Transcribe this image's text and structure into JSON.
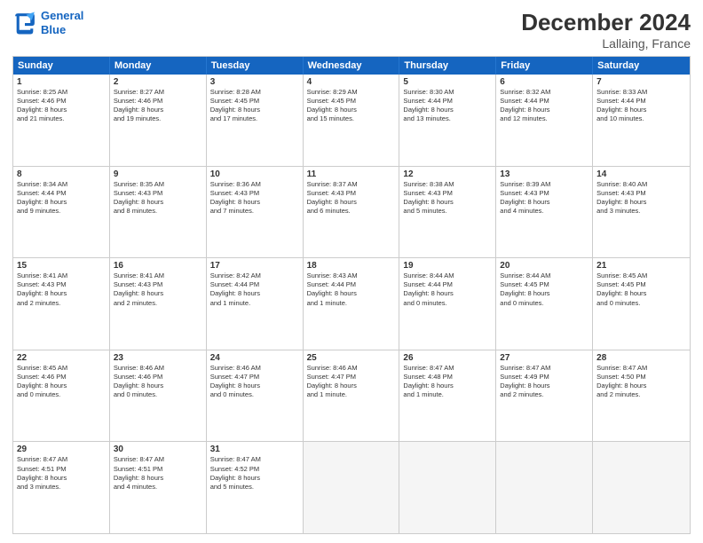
{
  "logo": {
    "line1": "General",
    "line2": "Blue"
  },
  "title": "December 2024",
  "subtitle": "Lallaing, France",
  "header": {
    "days": [
      "Sunday",
      "Monday",
      "Tuesday",
      "Wednesday",
      "Thursday",
      "Friday",
      "Saturday"
    ]
  },
  "rows": [
    [
      {
        "day": "1",
        "lines": [
          "Sunrise: 8:25 AM",
          "Sunset: 4:46 PM",
          "Daylight: 8 hours",
          "and 21 minutes."
        ]
      },
      {
        "day": "2",
        "lines": [
          "Sunrise: 8:27 AM",
          "Sunset: 4:46 PM",
          "Daylight: 8 hours",
          "and 19 minutes."
        ]
      },
      {
        "day": "3",
        "lines": [
          "Sunrise: 8:28 AM",
          "Sunset: 4:45 PM",
          "Daylight: 8 hours",
          "and 17 minutes."
        ]
      },
      {
        "day": "4",
        "lines": [
          "Sunrise: 8:29 AM",
          "Sunset: 4:45 PM",
          "Daylight: 8 hours",
          "and 15 minutes."
        ]
      },
      {
        "day": "5",
        "lines": [
          "Sunrise: 8:30 AM",
          "Sunset: 4:44 PM",
          "Daylight: 8 hours",
          "and 13 minutes."
        ]
      },
      {
        "day": "6",
        "lines": [
          "Sunrise: 8:32 AM",
          "Sunset: 4:44 PM",
          "Daylight: 8 hours",
          "and 12 minutes."
        ]
      },
      {
        "day": "7",
        "lines": [
          "Sunrise: 8:33 AM",
          "Sunset: 4:44 PM",
          "Daylight: 8 hours",
          "and 10 minutes."
        ]
      }
    ],
    [
      {
        "day": "8",
        "lines": [
          "Sunrise: 8:34 AM",
          "Sunset: 4:44 PM",
          "Daylight: 8 hours",
          "and 9 minutes."
        ]
      },
      {
        "day": "9",
        "lines": [
          "Sunrise: 8:35 AM",
          "Sunset: 4:43 PM",
          "Daylight: 8 hours",
          "and 8 minutes."
        ]
      },
      {
        "day": "10",
        "lines": [
          "Sunrise: 8:36 AM",
          "Sunset: 4:43 PM",
          "Daylight: 8 hours",
          "and 7 minutes."
        ]
      },
      {
        "day": "11",
        "lines": [
          "Sunrise: 8:37 AM",
          "Sunset: 4:43 PM",
          "Daylight: 8 hours",
          "and 6 minutes."
        ]
      },
      {
        "day": "12",
        "lines": [
          "Sunrise: 8:38 AM",
          "Sunset: 4:43 PM",
          "Daylight: 8 hours",
          "and 5 minutes."
        ]
      },
      {
        "day": "13",
        "lines": [
          "Sunrise: 8:39 AM",
          "Sunset: 4:43 PM",
          "Daylight: 8 hours",
          "and 4 minutes."
        ]
      },
      {
        "day": "14",
        "lines": [
          "Sunrise: 8:40 AM",
          "Sunset: 4:43 PM",
          "Daylight: 8 hours",
          "and 3 minutes."
        ]
      }
    ],
    [
      {
        "day": "15",
        "lines": [
          "Sunrise: 8:41 AM",
          "Sunset: 4:43 PM",
          "Daylight: 8 hours",
          "and 2 minutes."
        ]
      },
      {
        "day": "16",
        "lines": [
          "Sunrise: 8:41 AM",
          "Sunset: 4:43 PM",
          "Daylight: 8 hours",
          "and 2 minutes."
        ]
      },
      {
        "day": "17",
        "lines": [
          "Sunrise: 8:42 AM",
          "Sunset: 4:44 PM",
          "Daylight: 8 hours",
          "and 1 minute."
        ]
      },
      {
        "day": "18",
        "lines": [
          "Sunrise: 8:43 AM",
          "Sunset: 4:44 PM",
          "Daylight: 8 hours",
          "and 1 minute."
        ]
      },
      {
        "day": "19",
        "lines": [
          "Sunrise: 8:44 AM",
          "Sunset: 4:44 PM",
          "Daylight: 8 hours",
          "and 0 minutes."
        ]
      },
      {
        "day": "20",
        "lines": [
          "Sunrise: 8:44 AM",
          "Sunset: 4:45 PM",
          "Daylight: 8 hours",
          "and 0 minutes."
        ]
      },
      {
        "day": "21",
        "lines": [
          "Sunrise: 8:45 AM",
          "Sunset: 4:45 PM",
          "Daylight: 8 hours",
          "and 0 minutes."
        ]
      }
    ],
    [
      {
        "day": "22",
        "lines": [
          "Sunrise: 8:45 AM",
          "Sunset: 4:46 PM",
          "Daylight: 8 hours",
          "and 0 minutes."
        ]
      },
      {
        "day": "23",
        "lines": [
          "Sunrise: 8:46 AM",
          "Sunset: 4:46 PM",
          "Daylight: 8 hours",
          "and 0 minutes."
        ]
      },
      {
        "day": "24",
        "lines": [
          "Sunrise: 8:46 AM",
          "Sunset: 4:47 PM",
          "Daylight: 8 hours",
          "and 0 minutes."
        ]
      },
      {
        "day": "25",
        "lines": [
          "Sunrise: 8:46 AM",
          "Sunset: 4:47 PM",
          "Daylight: 8 hours",
          "and 1 minute."
        ]
      },
      {
        "day": "26",
        "lines": [
          "Sunrise: 8:47 AM",
          "Sunset: 4:48 PM",
          "Daylight: 8 hours",
          "and 1 minute."
        ]
      },
      {
        "day": "27",
        "lines": [
          "Sunrise: 8:47 AM",
          "Sunset: 4:49 PM",
          "Daylight: 8 hours",
          "and 2 minutes."
        ]
      },
      {
        "day": "28",
        "lines": [
          "Sunrise: 8:47 AM",
          "Sunset: 4:50 PM",
          "Daylight: 8 hours",
          "and 2 minutes."
        ]
      }
    ],
    [
      {
        "day": "29",
        "lines": [
          "Sunrise: 8:47 AM",
          "Sunset: 4:51 PM",
          "Daylight: 8 hours",
          "and 3 minutes."
        ]
      },
      {
        "day": "30",
        "lines": [
          "Sunrise: 8:47 AM",
          "Sunset: 4:51 PM",
          "Daylight: 8 hours",
          "and 4 minutes."
        ]
      },
      {
        "day": "31",
        "lines": [
          "Sunrise: 8:47 AM",
          "Sunset: 4:52 PM",
          "Daylight: 8 hours",
          "and 5 minutes."
        ]
      },
      {
        "day": "",
        "lines": []
      },
      {
        "day": "",
        "lines": []
      },
      {
        "day": "",
        "lines": []
      },
      {
        "day": "",
        "lines": []
      }
    ]
  ]
}
